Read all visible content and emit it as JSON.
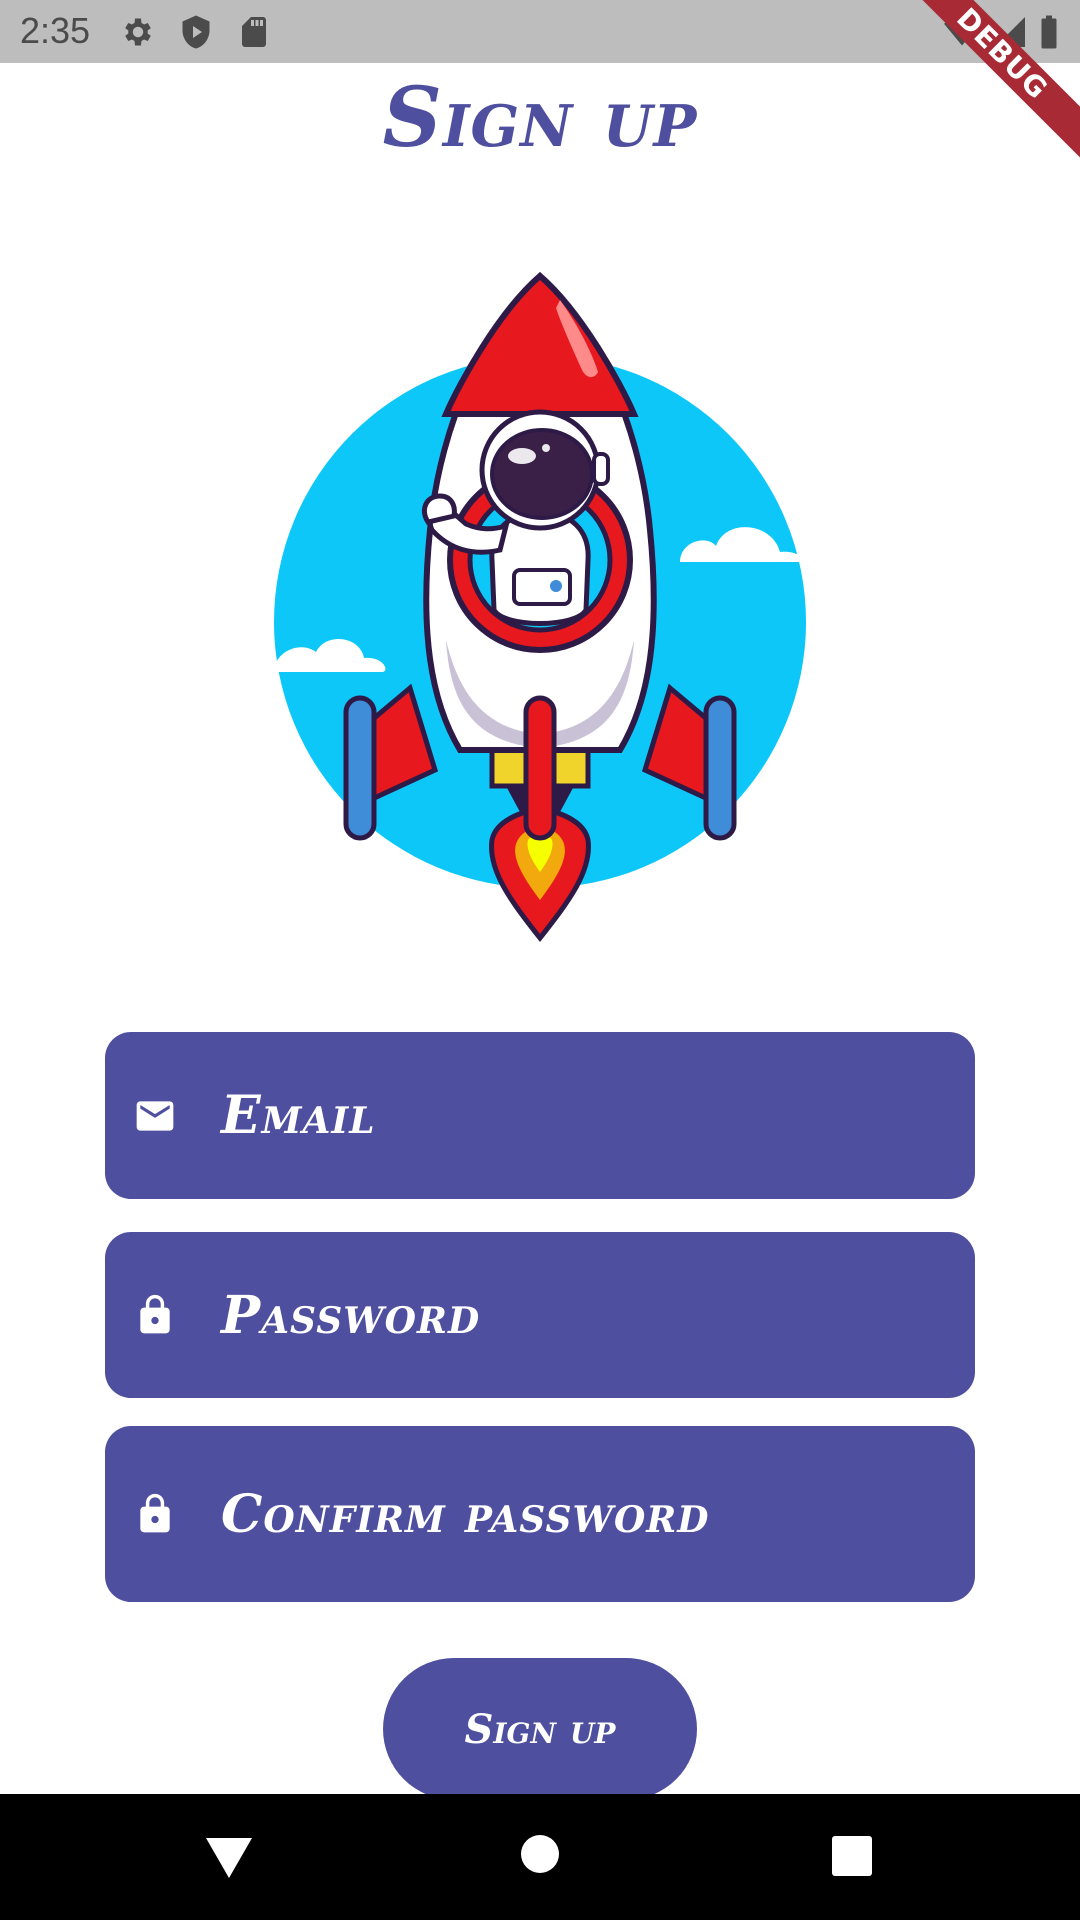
{
  "status_bar": {
    "time": "2:35",
    "icons": [
      "settings-gear-icon",
      "shield-play-icon",
      "sd-card-icon",
      "wifi-icon",
      "signal-icon",
      "battery-icon"
    ]
  },
  "debug_banner": "DEBUG",
  "page": {
    "title": "Sign up"
  },
  "form": {
    "email": {
      "placeholder": "Email",
      "icon": "mail-icon"
    },
    "password": {
      "placeholder": "Password",
      "icon": "lock-icon"
    },
    "confirm_password": {
      "placeholder": "Confirm password",
      "icon": "lock-icon"
    }
  },
  "signup_button": "Sign up",
  "nav_bar": {
    "icons": [
      "back-triangle-icon",
      "home-circle-icon",
      "recents-square-icon"
    ]
  },
  "colors": {
    "accent": "#4f4f9f",
    "status_bar": "#bdbdbd",
    "sky": "#0dc7f8",
    "rocket_red": "#e8191e"
  }
}
